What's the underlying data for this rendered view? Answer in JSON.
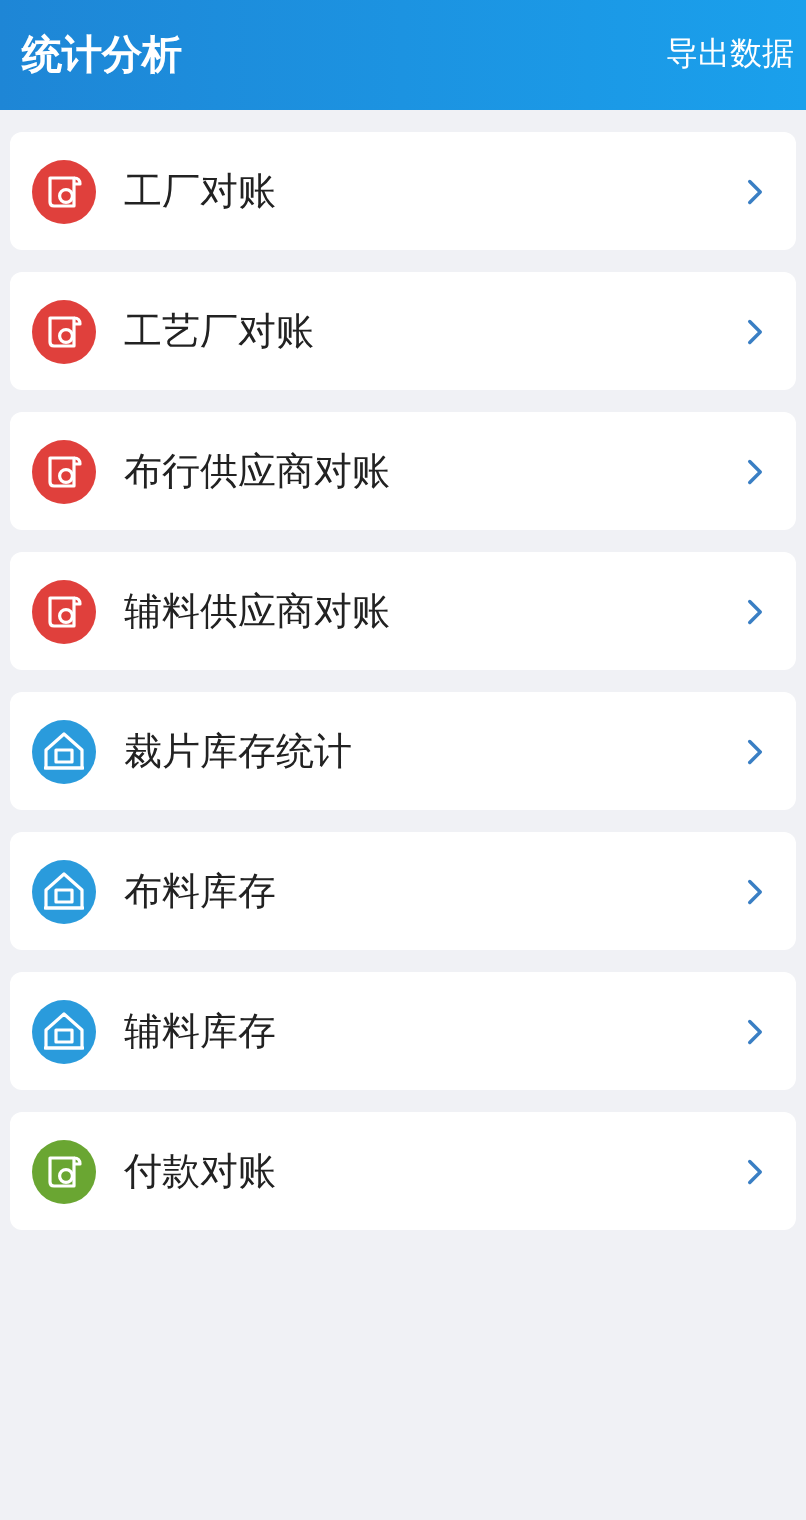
{
  "header": {
    "title": "统计分析",
    "action": "导出数据"
  },
  "items": [
    {
      "label": "工厂对账",
      "kind": "ledger",
      "color": "#e0403c"
    },
    {
      "label": "工艺厂对账",
      "kind": "ledger",
      "color": "#e0403c"
    },
    {
      "label": "布行供应商对账",
      "kind": "ledger",
      "color": "#e0403c"
    },
    {
      "label": "辅料供应商对账",
      "kind": "ledger",
      "color": "#e0403c"
    },
    {
      "label": "裁片库存统计",
      "kind": "warehouse",
      "color": "#2a9bdc"
    },
    {
      "label": "布料库存",
      "kind": "warehouse",
      "color": "#2a9bdc"
    },
    {
      "label": "辅料库存",
      "kind": "warehouse",
      "color": "#2a9bdc"
    },
    {
      "label": "付款对账",
      "kind": "ledger",
      "color": "#6aa632"
    }
  ]
}
